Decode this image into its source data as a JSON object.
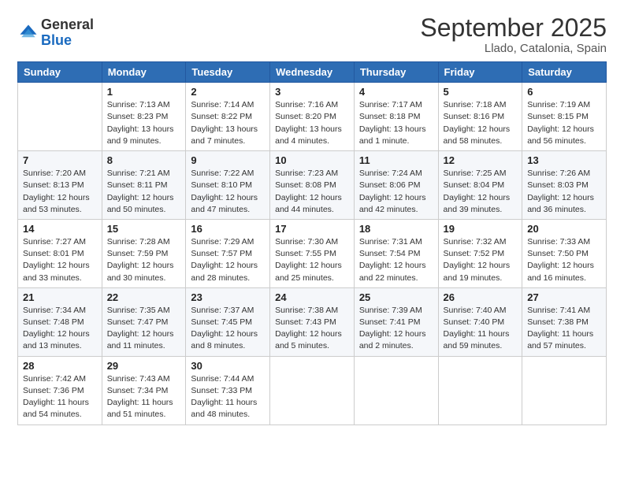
{
  "logo": {
    "general": "General",
    "blue": "Blue"
  },
  "header": {
    "title": "September 2025",
    "subtitle": "Llado, Catalonia, Spain"
  },
  "weekdays": [
    "Sunday",
    "Monday",
    "Tuesday",
    "Wednesday",
    "Thursday",
    "Friday",
    "Saturday"
  ],
  "weeks": [
    [
      {
        "day": "",
        "info": ""
      },
      {
        "day": "1",
        "info": "Sunrise: 7:13 AM\nSunset: 8:23 PM\nDaylight: 13 hours\nand 9 minutes."
      },
      {
        "day": "2",
        "info": "Sunrise: 7:14 AM\nSunset: 8:22 PM\nDaylight: 13 hours\nand 7 minutes."
      },
      {
        "day": "3",
        "info": "Sunrise: 7:16 AM\nSunset: 8:20 PM\nDaylight: 13 hours\nand 4 minutes."
      },
      {
        "day": "4",
        "info": "Sunrise: 7:17 AM\nSunset: 8:18 PM\nDaylight: 13 hours\nand 1 minute."
      },
      {
        "day": "5",
        "info": "Sunrise: 7:18 AM\nSunset: 8:16 PM\nDaylight: 12 hours\nand 58 minutes."
      },
      {
        "day": "6",
        "info": "Sunrise: 7:19 AM\nSunset: 8:15 PM\nDaylight: 12 hours\nand 56 minutes."
      }
    ],
    [
      {
        "day": "7",
        "info": "Sunrise: 7:20 AM\nSunset: 8:13 PM\nDaylight: 12 hours\nand 53 minutes."
      },
      {
        "day": "8",
        "info": "Sunrise: 7:21 AM\nSunset: 8:11 PM\nDaylight: 12 hours\nand 50 minutes."
      },
      {
        "day": "9",
        "info": "Sunrise: 7:22 AM\nSunset: 8:10 PM\nDaylight: 12 hours\nand 47 minutes."
      },
      {
        "day": "10",
        "info": "Sunrise: 7:23 AM\nSunset: 8:08 PM\nDaylight: 12 hours\nand 44 minutes."
      },
      {
        "day": "11",
        "info": "Sunrise: 7:24 AM\nSunset: 8:06 PM\nDaylight: 12 hours\nand 42 minutes."
      },
      {
        "day": "12",
        "info": "Sunrise: 7:25 AM\nSunset: 8:04 PM\nDaylight: 12 hours\nand 39 minutes."
      },
      {
        "day": "13",
        "info": "Sunrise: 7:26 AM\nSunset: 8:03 PM\nDaylight: 12 hours\nand 36 minutes."
      }
    ],
    [
      {
        "day": "14",
        "info": "Sunrise: 7:27 AM\nSunset: 8:01 PM\nDaylight: 12 hours\nand 33 minutes."
      },
      {
        "day": "15",
        "info": "Sunrise: 7:28 AM\nSunset: 7:59 PM\nDaylight: 12 hours\nand 30 minutes."
      },
      {
        "day": "16",
        "info": "Sunrise: 7:29 AM\nSunset: 7:57 PM\nDaylight: 12 hours\nand 28 minutes."
      },
      {
        "day": "17",
        "info": "Sunrise: 7:30 AM\nSunset: 7:55 PM\nDaylight: 12 hours\nand 25 minutes."
      },
      {
        "day": "18",
        "info": "Sunrise: 7:31 AM\nSunset: 7:54 PM\nDaylight: 12 hours\nand 22 minutes."
      },
      {
        "day": "19",
        "info": "Sunrise: 7:32 AM\nSunset: 7:52 PM\nDaylight: 12 hours\nand 19 minutes."
      },
      {
        "day": "20",
        "info": "Sunrise: 7:33 AM\nSunset: 7:50 PM\nDaylight: 12 hours\nand 16 minutes."
      }
    ],
    [
      {
        "day": "21",
        "info": "Sunrise: 7:34 AM\nSunset: 7:48 PM\nDaylight: 12 hours\nand 13 minutes."
      },
      {
        "day": "22",
        "info": "Sunrise: 7:35 AM\nSunset: 7:47 PM\nDaylight: 12 hours\nand 11 minutes."
      },
      {
        "day": "23",
        "info": "Sunrise: 7:37 AM\nSunset: 7:45 PM\nDaylight: 12 hours\nand 8 minutes."
      },
      {
        "day": "24",
        "info": "Sunrise: 7:38 AM\nSunset: 7:43 PM\nDaylight: 12 hours\nand 5 minutes."
      },
      {
        "day": "25",
        "info": "Sunrise: 7:39 AM\nSunset: 7:41 PM\nDaylight: 12 hours\nand 2 minutes."
      },
      {
        "day": "26",
        "info": "Sunrise: 7:40 AM\nSunset: 7:40 PM\nDaylight: 11 hours\nand 59 minutes."
      },
      {
        "day": "27",
        "info": "Sunrise: 7:41 AM\nSunset: 7:38 PM\nDaylight: 11 hours\nand 57 minutes."
      }
    ],
    [
      {
        "day": "28",
        "info": "Sunrise: 7:42 AM\nSunset: 7:36 PM\nDaylight: 11 hours\nand 54 minutes."
      },
      {
        "day": "29",
        "info": "Sunrise: 7:43 AM\nSunset: 7:34 PM\nDaylight: 11 hours\nand 51 minutes."
      },
      {
        "day": "30",
        "info": "Sunrise: 7:44 AM\nSunset: 7:33 PM\nDaylight: 11 hours\nand 48 minutes."
      },
      {
        "day": "",
        "info": ""
      },
      {
        "day": "",
        "info": ""
      },
      {
        "day": "",
        "info": ""
      },
      {
        "day": "",
        "info": ""
      }
    ]
  ]
}
